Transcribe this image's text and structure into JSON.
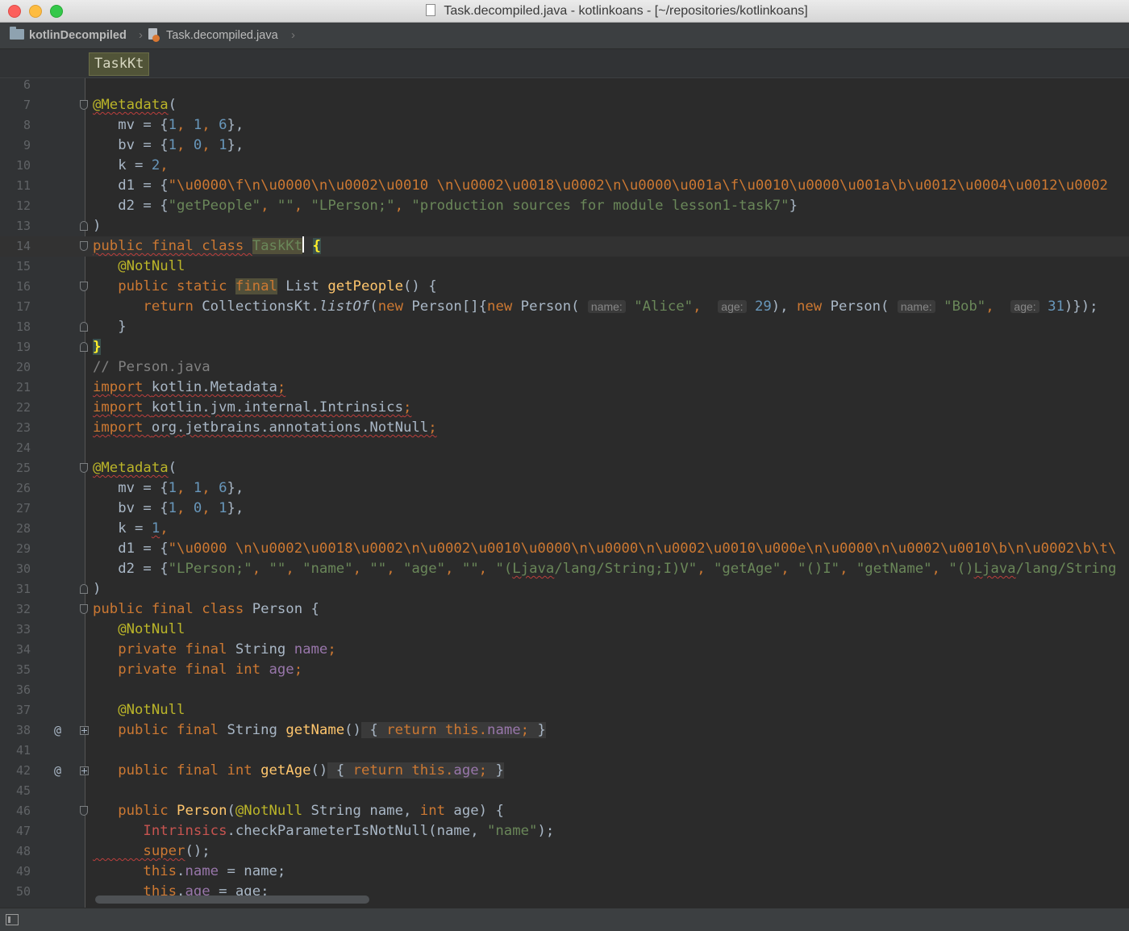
{
  "window": {
    "title": "Task.decompiled.java - kotlinkoans - [~/repositories/kotlinkoans]"
  },
  "navbar": {
    "project": "kotlinDecompiled",
    "file": "Task.decompiled.java",
    "separator": "›"
  },
  "breadcrumb": {
    "class": "TaskKt"
  },
  "hints": {
    "name": "name:",
    "age": "age:"
  },
  "editor": {
    "line_numbers": [
      "6",
      "7",
      "8",
      "9",
      "10",
      "11",
      "12",
      "13",
      "14",
      "15",
      "16",
      "17",
      "18",
      "19",
      "20",
      "21",
      "22",
      "23",
      "24",
      "25",
      "26",
      "27",
      "28",
      "29",
      "30",
      "31",
      "32",
      "33",
      "34",
      "35",
      "36",
      "37",
      "38",
      "41",
      "42",
      "45",
      "46",
      "47",
      "48",
      "49",
      "50"
    ],
    "lines": {
      "l7": {
        "ann": "@Metadata",
        "rest": "("
      },
      "l8": {
        "a": "   mv = {",
        "n1": "1",
        "c1": ", ",
        "n2": "1",
        "c2": ", ",
        "n3": "6",
        "e": "},"
      },
      "l9": {
        "a": "   bv = {",
        "n1": "1",
        "c1": ", ",
        "n2": "0",
        "c2": ", ",
        "n3": "1",
        "e": "},"
      },
      "l10": {
        "a": "   k = ",
        "n": "2",
        "e": ","
      },
      "l11": {
        "a": "   d1 = {",
        "s": "\"\\u0000\\f\\n\\u0000\\n\\u0002\\u0010 \\n\\u0002\\u0018\\u0002\\n\\u0000\\u001a\\f\\u0010\\u0000\\u001a\\b\\u0012\\u0004\\u0012\\u0002"
      },
      "l12": {
        "a": "   d2 = {",
        "s1": "\"getPeople\"",
        "c1": ", ",
        "s2": "\"\"",
        "c2": ", ",
        "s3": "\"LPerson;\"",
        "c3": ", ",
        "s4": "\"production sources for module lesson1-task7\"",
        "e": "}"
      },
      "l13": {
        "t": ")"
      },
      "l14": {
        "kw": "public final class ",
        "cls": "TaskKt",
        "sp": " ",
        "br": "{"
      },
      "l15": {
        "ann": "   @NotNull"
      },
      "l16": {
        "kw1": "   public static ",
        "kw2": "final",
        "t1": " List ",
        "fn": "getPeople",
        "t2": "() {"
      },
      "l17": {
        "kw1": "      return ",
        "t1": "CollectionsKt.",
        "fn": "listOf",
        "t2": "(",
        "kw2": "new ",
        "t3": "Person[]{",
        "kw3": "new ",
        "t4": "Person( ",
        "s1": "\"Alice\"",
        "c1": ",  ",
        "n1": "29",
        "t5": "), ",
        "kw4": "new ",
        "t6": "Person( ",
        "s2": "\"Bob\"",
        "c2": ",  ",
        "n2": "31",
        "t7": ")});"
      },
      "l18": {
        "t": "   }"
      },
      "l19": {
        "br": "}"
      },
      "l20": {
        "cmt": "// Person.java"
      },
      "l21": {
        "kw": "import ",
        "t": "kotlin.Metadata",
        "e": ";"
      },
      "l22": {
        "kw": "import ",
        "t": "kotlin.jvm.internal.Intrinsics",
        "e": ";"
      },
      "l23": {
        "kw": "import ",
        "t": "org.jetbrains.annotations.NotNull",
        "e": ";"
      },
      "l25": {
        "ann": "@Metadata",
        "rest": "("
      },
      "l26": {
        "a": "   mv = {",
        "n1": "1",
        "c1": ", ",
        "n2": "1",
        "c2": ", ",
        "n3": "6",
        "e": "},"
      },
      "l27": {
        "a": "   bv = {",
        "n1": "1",
        "c1": ", ",
        "n2": "0",
        "c2": ", ",
        "n3": "1",
        "e": "},"
      },
      "l28": {
        "a": "   k = ",
        "n": "1",
        "e": ","
      },
      "l29": {
        "a": "   d1 = {",
        "s": "\"\\u0000 \\n\\u0002\\u0018\\u0002\\n\\u0002\\u0010\\u0000\\n\\u0000\\n\\u0002\\u0010\\u000e\\n\\u0000\\n\\u0002\\u0010\\b\\n\\u0002\\b\\t\\"
      },
      "l30": {
        "a": "   d2 = {",
        "s1": "\"LPerson;\"",
        "c1": ", ",
        "s2": "\"\"",
        "c2": ", ",
        "s3": "\"name\"",
        "c3": ", ",
        "s4": "\"\"",
        "c4": ", ",
        "s5": "\"age\"",
        "c5": ", ",
        "s6": "\"\"",
        "c6": ", ",
        "s7a": "\"(",
        "s7b": "Ljava",
        "s7c": "/lang/String;I)V\"",
        "c7": ", ",
        "s8": "\"getAge\"",
        "c8": ", ",
        "s9": "\"()I\"",
        "c9": ", ",
        "s10": "\"getName\"",
        "c10": ", ",
        "s11a": "\"()",
        "s11b": "Ljava",
        "s11c": "/lang/String"
      },
      "l31": {
        "t": ")"
      },
      "l32": {
        "kw": "public final class ",
        "t": "Person {"
      },
      "l33": {
        "ann": "   @NotNull"
      },
      "l34": {
        "kw": "   private final ",
        "t": "String ",
        "f": "name",
        "e": ";"
      },
      "l35": {
        "kw": "   private final int ",
        "f": "age",
        "e": ";"
      },
      "l37": {
        "ann": "   @NotNull"
      },
      "l38": {
        "kw": "   public final ",
        "t": "String ",
        "fn": "getName",
        "t2": "()",
        "g1": " { ",
        "kw2": "return this.",
        "f": "name",
        "g2": "; ",
        "g3": "}"
      },
      "l42": {
        "kw": "   public final int ",
        "fn": "getAge",
        "t2": "()",
        "g1": " { ",
        "kw2": "return this.",
        "f": "age",
        "g2": "; ",
        "g3": "}"
      },
      "l46": {
        "kw": "   public ",
        "fn": "Person",
        "t1": "(",
        "ann": "@NotNull",
        "t2": " String name, ",
        "kw2": "int ",
        "t3": "age) {"
      },
      "l47": {
        "red": "      Intrinsics",
        "t1": ".checkParameterIsNotNull(name, ",
        "s": "\"name\"",
        "t2": ");"
      },
      "l48": {
        "kw": "      super",
        "t": "();"
      },
      "l49": {
        "kw": "      this",
        "t1": ".",
        "f": "name",
        "t2": " = name;"
      },
      "l50": {
        "kw": "      this",
        "t1": ".",
        "f": "age",
        "t2": " = age;"
      }
    }
  },
  "gutter_marks": {
    "at": "@"
  }
}
